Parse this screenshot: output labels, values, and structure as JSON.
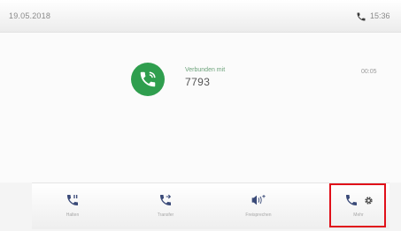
{
  "status_bar": {
    "date": "19.05.2018",
    "time": "15:36",
    "phone_icon": "phone-icon"
  },
  "call": {
    "status": "Verbunden mit",
    "number": "7793",
    "duration": "00:05",
    "avatar_icon": "phone-in-call-icon",
    "accent": "#2f9e4e"
  },
  "actions": [
    {
      "label": "Halten",
      "icon": "phone-hold-icon"
    },
    {
      "label": "Transfer",
      "icon": "phone-transfer-icon"
    },
    {
      "label": "Freisprechen",
      "icon": "speaker-icon"
    },
    {
      "label": "Mehr",
      "icon": "phone-settings-icon"
    }
  ],
  "highlight_color": "#e0101a"
}
